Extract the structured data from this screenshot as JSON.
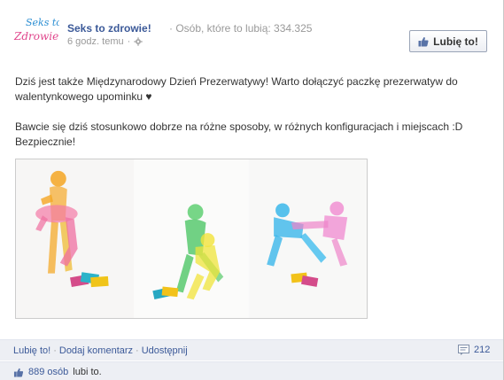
{
  "page": {
    "name": "Seks to zdrowie!",
    "logo_text_line1": "Seks to",
    "logo_text_line2": "Zdrowie!",
    "likes_label": "· Osób, które to lubią: 334.325",
    "time": "6 godz. temu",
    "time_sep": "·"
  },
  "like_button": {
    "label": "Lubię to!",
    "icon": "thumbs-up-icon"
  },
  "post": {
    "paragraph1": "Dziś jest także Międzynarodowy Dzień Prezerwatywy! Warto dołączyć paczkę prezerwatyw do walentynkowego upominku ♥",
    "paragraph2": "Bawcie się dziś stosunkowo dobrze na różne sposoby, w różnych konfiguracjach i miejscach :D Bezpiecznie!"
  },
  "actions": {
    "like": "Lubię to!",
    "comment": "Dodaj komentarz",
    "share": "Udostępnij",
    "sep": "·",
    "comment_count": "212"
  },
  "likes_summary": {
    "count": "889 osób",
    "suffix": "lubi to."
  },
  "colors": {
    "link": "#3b5998",
    "bar_bg": "#edeff4",
    "logo_pink": "#e0468c",
    "logo_blue": "#2c8fd3"
  }
}
